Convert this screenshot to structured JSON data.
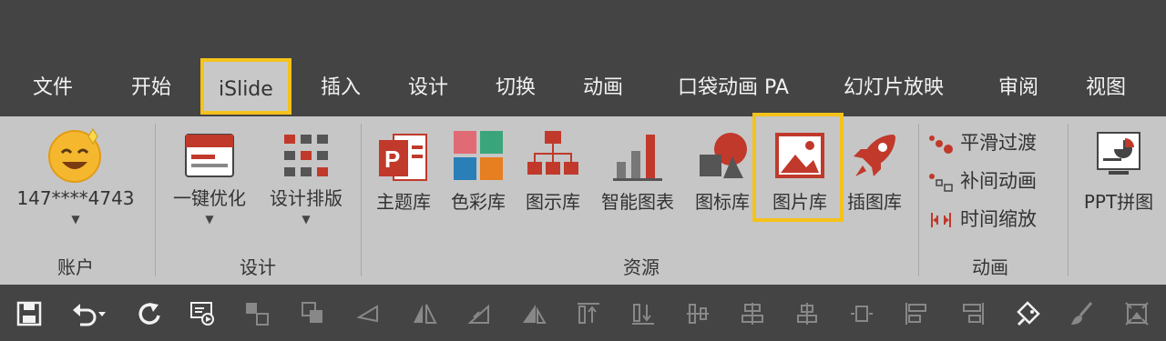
{
  "menu": {
    "tabs": [
      {
        "label": "文件"
      },
      {
        "label": "开始"
      },
      {
        "label": "iSlide"
      },
      {
        "label": "插入"
      },
      {
        "label": "设计"
      },
      {
        "label": "切换"
      },
      {
        "label": "动画"
      },
      {
        "label": "口袋动画 PA"
      },
      {
        "label": "幻灯片放映"
      },
      {
        "label": "审阅"
      },
      {
        "label": "视图"
      }
    ]
  },
  "ribbon": {
    "account": {
      "username": "147****4743",
      "group_label": "账户"
    },
    "design": {
      "one_click_optimize": "一键优化",
      "design_layout": "设计排版",
      "group_label": "设计"
    },
    "resources": {
      "theme_library": "主题库",
      "color_library": "色彩库",
      "diagram_library": "图示库",
      "smart_chart": "智能图表",
      "icon_library": "图标库",
      "picture_library": "图片库",
      "illustration_library": "插图库",
      "group_label": "资源"
    },
    "animation": {
      "smooth_transition": "平滑过渡",
      "tween_animation": "补间动画",
      "time_scale": "时间缩放",
      "group_label": "动画"
    },
    "ppt_collage": "PPT拼图"
  },
  "colors": {
    "highlight": "#f4c21a",
    "accent_red": "#c0392b",
    "ribbon_bg": "#c6c6c6",
    "chrome_bg": "#444444"
  }
}
